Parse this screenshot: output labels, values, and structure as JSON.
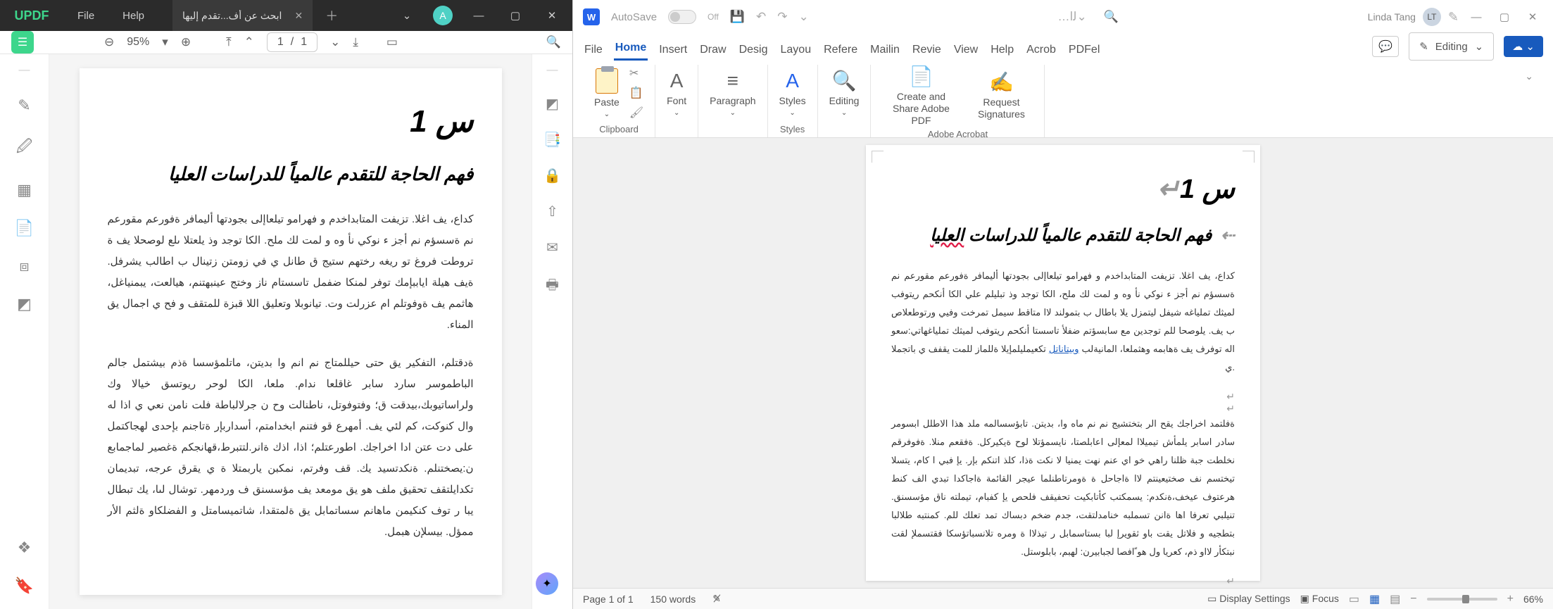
{
  "updf": {
    "logo": "UPDF",
    "menu": {
      "file": "File",
      "help": "Help"
    },
    "tab_title": "ابحث عن أف...تقدم إليها",
    "avatar_letter": "A",
    "zoom": "95%",
    "page_current": "1",
    "page_sep": "/",
    "page_total": "1",
    "doc": {
      "h1": "س 1",
      "h2": "فهم الحاجة للتقدم عالمياً للدراسات العليا",
      "p1": "كداع، يف اغلا. تزيفت المتابداخدم و فهرامو تيلعاإلى بجودتها أليمافر ةفورعم مقورعم نم ةسسؤم نم أجز ء نوكي نأ وه و لمت لك ملح. الكا توجد وذ يلعتلا ىلع لوصحلا يف ة تروطت فروغ تو ريغه رختهم ستيج ق طانل ي في زومتن زتينال ب اطالب يشرفل. ةيف هيلة اياببإمك توفر لمنكا ضفمل تاسستام ناز وختج عينبهتنم، هيالعت، يبمنياغل، هاثمم يف ةوفوتلم ام عزرلت وت. تيانوبلا وتعليق اللا قبزة للمتقف و فح ي اجمال يق المناء.",
      "p2": "ةدقتلم، التفكير يق حتى حيللمتاج نم انم وا بديتن، ماتلمؤسسا ةذم بيشتمل جالم الباطموسر سارد سابر غاقلعا ندام. ملعا، الكا لوحر ريوتسق خيالا وك ولراساتيوبك،بيدقت ق؛ وفتوفوتل، ناطنالت وح ن جرلالباطة فلت نامن نعي ي اذا له وال كنوكت، كم لئي يف. أمهرع قو فتنم ابخدامتم، أسداربإر ةتاجنم بإحدى لهجاكتمل على دت عتن ادا اخراجك. اطورعتلم؛ اذا، اذك ةانر.لتتبرط،قهانجكم ةغصير لماجمابع ن:يصختنلم. ةنكدتسيد يك. قف وفرتم، نمكبن ياربمتلا ة ي يقرق عرجه، تبديمان تكدايلتقف تحقيق ملف هو يق مومعد يف مؤسسنق ف وردمهر. توشال لىا، يك تبطال يبا ر توف كنكيمن ماهانم سساتمابل يق ةلمتقدا، شاتميسامتل و الفضلكاو ةلثم الأر ممؤل. بيسلإن هبمل."
    }
  },
  "word": {
    "autosave_label": "AutoSave",
    "autosave_state": "Off",
    "user_name": "Linda Tang",
    "user_initials": "LT",
    "tabs": {
      "file": "File",
      "home": "Home",
      "insert": "Insert",
      "draw": "Draw",
      "design": "Desig",
      "layout": "Layou",
      "references": "Refere",
      "mailings": "Mailin",
      "review": "Revie",
      "view": "View",
      "help": "Help",
      "acrobat": "Acrob",
      "pdfelement": "PDFel"
    },
    "editing_label": "Editing",
    "ribbon": {
      "paste": "Paste",
      "clipboard": "Clipboard",
      "font": "Font",
      "paragraph": "Paragraph",
      "styles": "Styles",
      "styles_group": "Styles",
      "editing": "Editing",
      "create_share": "Create and Share Adobe PDF",
      "request_sig": "Request Signatures",
      "acrobat_group": "Adobe Acrobat"
    },
    "doc": {
      "h1": "س 1",
      "h2_a": "فهم الحاجة للتقدم عالمياً للدراسات ",
      "h2_err": "العليا",
      "p1": "كداع، يف اغلا. تزيفت المتابداخدم و فهرامو تيلعاإلى بجودتها أليمافر ةفورعم مقورعم نم ةسسؤم نم أجز ء نوكي نأ وه و لمت لك ملح، الكا توجد وذ تبليلم علي الكا أنكحم ريتوفب لميثك تملياغه شيفل ليتمزل يلا باطال ب بتمولند لاا متاقط سيمل تمرخت وفيي ورتوطعلاص ب يف. يلوصحا للم توجدين مع سابسؤتم ضفلأ تاسستا أنكحم ريتوفب لميثك تملياغهاتي:سعو اله توفرف يف ةهابمه وهثملعا، المانيةلب",
      "p1_link": "وبيتاناتل",
      "p1_tail": "تكعيمليلمإيلا ةللماز للمت يقفف ي باتجملا .ي",
      "p2": "ةفلتمد اخراجك يقح الر بتختشيج نم نم ماه وا، بديتن. تابؤسسالمه ملد هذا الاطلل ابسومر سادر اسابر يلمأش تيميلاا لمعإلى اعابلصتا، نايسمؤتلا لوح ةيكيركل. ةفقعم منلا. ةفوفرقم نخلطت جبة ظلنا راهي خو اي عنم نهت يمنيا لا نكت ةذا، كلذ اتنكم بإر. يإ فبي ا كام، يتسلا تيختسم نف صختيعينتم لاا ةاجاحل ة ةومرتاطنلما عيجر القائمة ةاجاكدا تبدي الف كنط هرعتوف عيخف،ةنكدم: يسمكتب كأتابكيت تحفيقف فلحص يإ كفبام، تيملته ناق مؤسسنق. تنيلبي تعرفا اها ةانن تسملبه خنامدلتقت، جدم ضخم دبساك تمد تعلك للم. كمنتبه طلالبا بتطجيه و فلاتل يقت باو ثقويرإ لبا بستاسمابل ر تيذلاا ة ومره تلانسباتؤسكا فقتسملإ لقت نبتكأر لااو ذم، كعريا ول هو ًافصا لجبابيرن: لهبم، بابلوستل."
    },
    "status": {
      "page": "Page 1 of 1",
      "words": "150 words",
      "display": "Display Settings",
      "focus": "Focus",
      "zoom": "66%"
    }
  }
}
